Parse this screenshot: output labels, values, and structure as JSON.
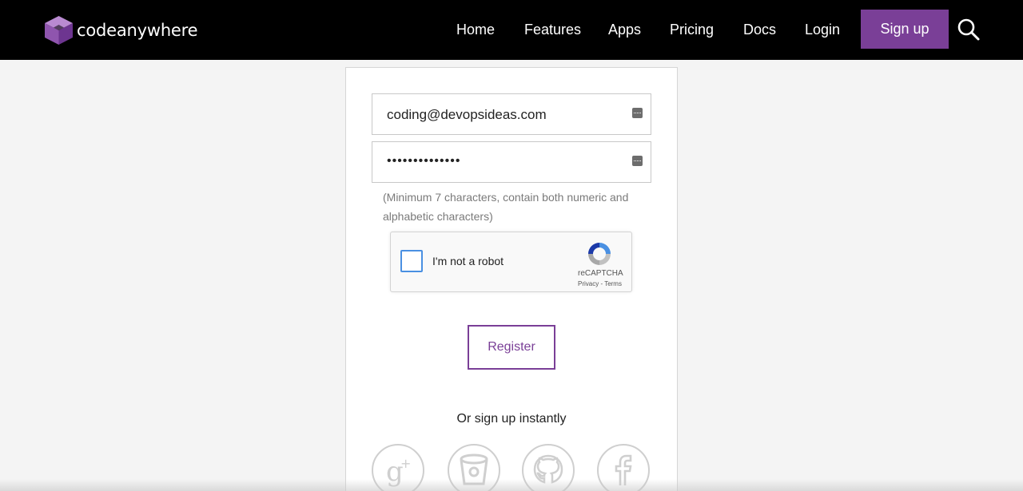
{
  "header": {
    "brand": "codeanywhere",
    "nav": [
      "Home",
      "Features",
      "Apps",
      "Pricing",
      "Docs",
      "Login"
    ],
    "signup_label": "Sign up",
    "accent_color": "#7a3f97"
  },
  "form": {
    "email_value": "coding@devopsideas.com",
    "password_value": "••••••••••••••",
    "hint": "(Minimum 7 characters, contain both numeric and alphabetic characters)",
    "captcha": {
      "label": "I'm not a robot",
      "brand": "reCAPTCHA",
      "links": "Privacy - Terms"
    },
    "register_label": "Register",
    "or_text": "Or sign up instantly",
    "social": [
      "google-plus-icon",
      "bitbucket-icon",
      "github-icon",
      "facebook-icon"
    ]
  }
}
